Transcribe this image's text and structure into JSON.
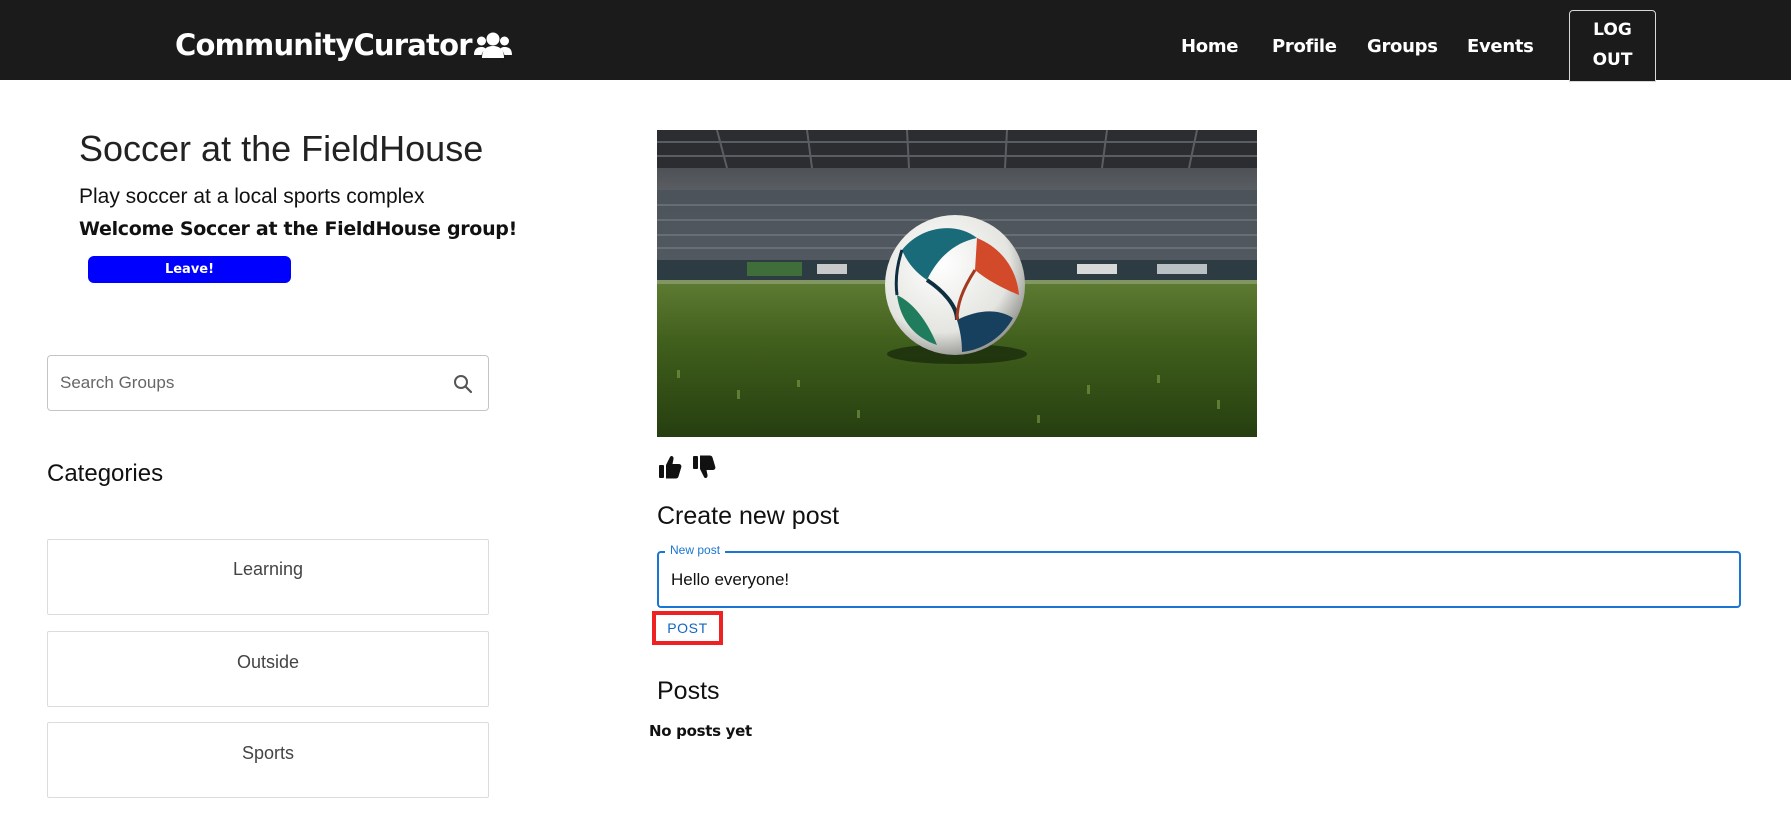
{
  "header": {
    "brand": "CommunityCurator",
    "brand_icon": "users-icon",
    "nav": {
      "home": "Home",
      "profile": "Profile",
      "groups": "Groups",
      "events": "Events"
    },
    "logout_line1": "LOG",
    "logout_line2": "OUT"
  },
  "group": {
    "title": "Soccer at the FieldHouse",
    "description": "Play soccer at a local sports complex",
    "welcome": "Welcome Soccer at the FieldHouse group!",
    "leave_label": "Leave!"
  },
  "search": {
    "placeholder": "Search Groups",
    "value": "",
    "icon": "search-icon"
  },
  "categories": {
    "title": "Categories",
    "items": [
      "Learning",
      "Outside",
      "Sports"
    ]
  },
  "reactions": {
    "like_icon": "thumb-up-icon",
    "dislike_icon": "thumb-down-icon"
  },
  "create_post": {
    "title": "Create new post",
    "field_label": "New post",
    "field_value": "Hello everyone!",
    "submit_label": "POST"
  },
  "posts": {
    "title": "Posts",
    "empty_text": "No posts yet"
  },
  "colors": {
    "navbar": "#1b1b1b",
    "leave_button": "#0000ff",
    "field_focus": "#1976d2",
    "post_highlight": "#ee2222"
  }
}
